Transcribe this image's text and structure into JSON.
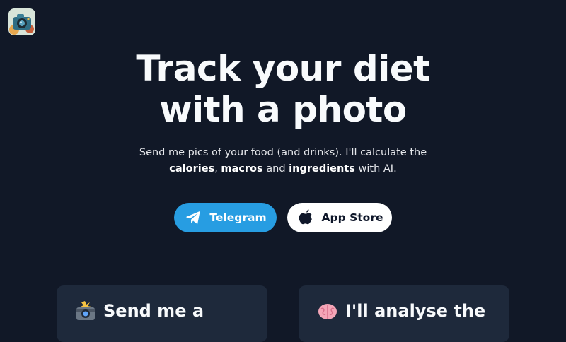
{
  "app": {
    "logo_icon": "camera-food-logo-icon"
  },
  "hero": {
    "title_line1": "Track your diet",
    "title_line2": "with a photo"
  },
  "subtitle": {
    "line1": "Send me pics of your food (and drinks). I'll calculate the",
    "bold1": "calories",
    "sep1": ", ",
    "bold2": "macros",
    "sep2": " and ",
    "bold3": "ingredients",
    "suffix": " with AI."
  },
  "buttons": {
    "telegram": {
      "label": "Telegram",
      "icon": "telegram-paper-plane-icon",
      "color": "#279de2"
    },
    "appstore": {
      "label": "App Store",
      "icon": "apple-icon",
      "color": "#ffffff"
    }
  },
  "cards": [
    {
      "icon": "camera-flash-emoji-icon",
      "title": "Send me a"
    },
    {
      "icon": "brain-emoji-icon",
      "title": "I'll analyse the"
    }
  ],
  "colors": {
    "background": "#111827",
    "card_background": "#1e293b",
    "text": "#f8fafc",
    "accent": "#279de2"
  }
}
